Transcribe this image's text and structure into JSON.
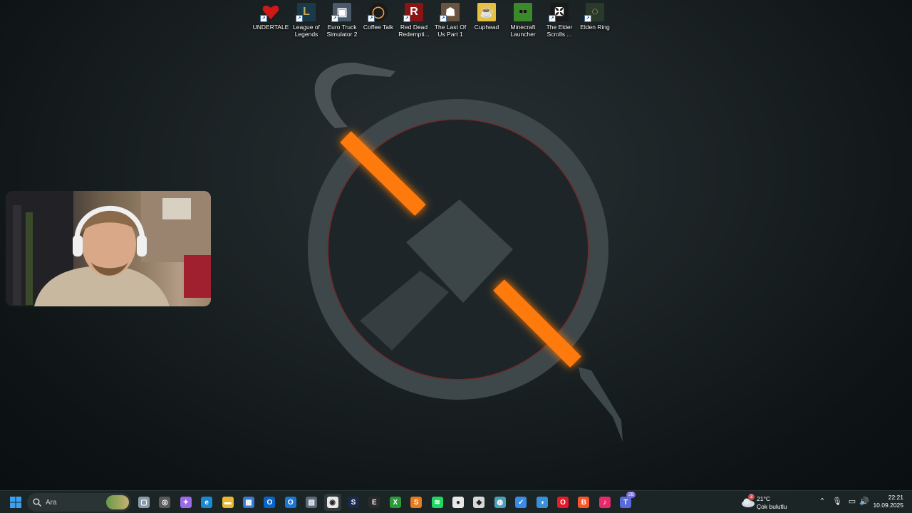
{
  "desktop": {
    "icons": [
      {
        "label": "UNDERTALE",
        "icon": "undertale-heart-icon",
        "color": "#d01818"
      },
      {
        "label": "League of\nLegends",
        "icon": "league-of-legends-icon",
        "color": "#1a3a4a"
      },
      {
        "label": "Euro Truck\nSimulator 2",
        "icon": "euro-truck-icon",
        "color": "#4a5a6a"
      },
      {
        "label": "Coffee Talk",
        "icon": "coffee-talk-icon",
        "color": "#3a2a2a"
      },
      {
        "label": "Red Dead\nRedempti...",
        "icon": "red-dead-icon",
        "color": "#8a1414"
      },
      {
        "label": "The Last Of\nUs Part 1",
        "icon": "last-of-us-icon",
        "color": "#5a4a3a"
      },
      {
        "label": "Cuphead",
        "icon": "cuphead-icon",
        "color": "#e8c040"
      },
      {
        "label": "Minecraft\nLauncher",
        "icon": "minecraft-icon",
        "color": "#3a8a2a"
      },
      {
        "label": "The Elder\nScrolls ...",
        "icon": "elder-scrolls-icon",
        "color": "#1a1a1a"
      },
      {
        "label": "Elden Ring",
        "icon": "elden-ring-icon",
        "color": "#2a3a2a"
      }
    ]
  },
  "taskbar": {
    "search_placeholder": "Ara",
    "apps": [
      {
        "name": "task-view-icon",
        "color": "#8a9aa8",
        "glyph": "▢"
      },
      {
        "name": "copilot-app-icon",
        "color": "#5a5a5a",
        "glyph": "◎"
      },
      {
        "name": "copilot-icon",
        "color": "#9a6ae8",
        "glyph": "✦"
      },
      {
        "name": "edge-icon",
        "color": "#1a8ad0",
        "glyph": "e"
      },
      {
        "name": "file-explorer-icon",
        "color": "#e8b830",
        "glyph": "▬"
      },
      {
        "name": "microsoft-store-icon",
        "color": "#3a7ad0",
        "glyph": "▦"
      },
      {
        "name": "outlook-icon",
        "color": "#0a64c8",
        "glyph": "O"
      },
      {
        "name": "outlook-new-icon",
        "color": "#1a78d4",
        "glyph": "O"
      },
      {
        "name": "calculator-icon",
        "color": "#5a6a7a",
        "glyph": "▤"
      },
      {
        "name": "chrome-icon",
        "color": "#e8e8e8",
        "glyph": "◉",
        "active": true
      },
      {
        "name": "steam-icon",
        "color": "#1a2a4a",
        "glyph": "S"
      },
      {
        "name": "epic-games-icon",
        "color": "#2a2a2a",
        "glyph": "E"
      },
      {
        "name": "xbox-icon",
        "color": "#2a9a3a",
        "glyph": "X"
      },
      {
        "name": "sublime-icon",
        "color": "#e87a20",
        "glyph": "S"
      },
      {
        "name": "spotify-icon",
        "color": "#1ed760",
        "glyph": "≋"
      },
      {
        "name": "obs-icon",
        "color": "#e8e8e8",
        "glyph": "●"
      },
      {
        "name": "unity-icon",
        "color": "#d8d8d8",
        "glyph": "◆"
      },
      {
        "name": "globe-app-icon",
        "color": "#4aa0b8",
        "glyph": "◍"
      },
      {
        "name": "todo-icon",
        "color": "#3a8ae8",
        "glyph": "✓"
      },
      {
        "name": "app-blue-icon",
        "color": "#3a90d8",
        "glyph": "◑"
      },
      {
        "name": "opera-icon",
        "color": "#e81a2a",
        "glyph": "O"
      },
      {
        "name": "brave-icon",
        "color": "#fb542b",
        "glyph": "B"
      },
      {
        "name": "tiktok-icon",
        "color": "#e82a6a",
        "glyph": "♪"
      },
      {
        "name": "teams-icon",
        "color": "#5a6ad8",
        "glyph": "T",
        "badge": "28"
      }
    ],
    "weather": {
      "temp": "21°C",
      "condition": "Çok bulutlu",
      "alert_count": "3"
    },
    "clock": {
      "time": "22:21",
      "date": "10.09.2025"
    }
  }
}
